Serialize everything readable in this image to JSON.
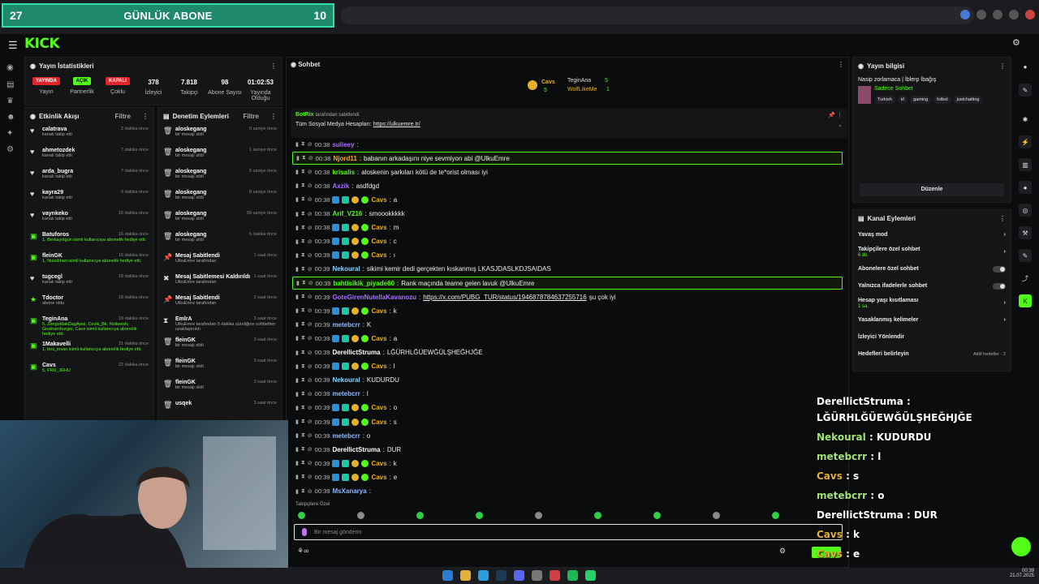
{
  "banner": {
    "left": "27",
    "title": "GÜNLÜK ABONE",
    "right": "10"
  },
  "app": {
    "logo": "KICK"
  },
  "stats": {
    "title": "Yayın İstatistikleri",
    "items": [
      {
        "badge": "YAYINDA",
        "badge_color": "#e2242b",
        "label": "Yayın"
      },
      {
        "badge": "AÇIK",
        "badge_color": "#53fc18",
        "label": "Partnerlik"
      },
      {
        "badge": "KAPALI",
        "badge_color": "#e2242b",
        "label": "Çoklu"
      },
      {
        "value": "378",
        "label": "İzleyici"
      },
      {
        "value": "7.818",
        "label": "Takipçi"
      },
      {
        "value": "98",
        "label": "Abone Sayısı"
      },
      {
        "value": "01:02:53",
        "label": "Yayında Olduğu"
      }
    ]
  },
  "activity": {
    "title": "Etkinlik Akışı",
    "filter": "Filtre",
    "items": [
      {
        "icon": "heart-icon",
        "name": "calatrava",
        "time": "2 dakika önce",
        "sub": "kanalı takip etti"
      },
      {
        "icon": "heart-icon",
        "name": "ahmetozdek",
        "time": "7 dakika önce",
        "sub": "kanalı takip etti"
      },
      {
        "icon": "heart-icon",
        "name": "arda_bugra",
        "time": "7 dakika önce",
        "sub": "kanalı takip etti"
      },
      {
        "icon": "heart-icon",
        "name": "kayra29",
        "time": "9 dakika önce",
        "sub": "kanalı takip etti"
      },
      {
        "icon": "heart-icon",
        "name": "vaynkeko",
        "time": "16 dakika önce",
        "sub": "kanalı takip etti"
      },
      {
        "icon": "gift-icon",
        "name": "Batuforos",
        "time": "16 dakika önce",
        "sub": "1, Berkayolgun isimli kullanıcıya abonelik hediye etti."
      },
      {
        "icon": "gift-icon",
        "name": "fleinGK",
        "time": "16 dakika önce",
        "sub": "1, Nusokhan isimli kullanıcıya abonelik hediye etti."
      },
      {
        "icon": "heart-icon",
        "name": "tugcegl",
        "time": "18 dakika önce",
        "sub": "kanalı takip etti"
      },
      {
        "icon": "star-icon",
        "name": "Tdoctor",
        "time": "18 dakika önce",
        "sub": "abone oldu"
      },
      {
        "icon": "gift-icon",
        "name": "TeginAna",
        "time": "19 dakika önce",
        "sub": "5, ZonguldakDagAyisi, Cevik_Bir, Noliwesh, Gezihamburger, Cavs isimli kullanıcıya abonelik hediye etti."
      },
      {
        "icon": "gift-icon",
        "name": "1Makavelli",
        "time": "21 dakika önce",
        "sub": "1, bos_insan isimli kullanıcıya abonelik hediye etti."
      },
      {
        "icon": "gift-icon",
        "name": "Cavs",
        "time": "22 dakika önce",
        "sub": "5, FRU_JEHU"
      }
    ]
  },
  "mod": {
    "title": "Denetim Eylemleri",
    "filter": "Filtre",
    "items": [
      {
        "icon": "trash-icon",
        "name": "aloskegang",
        "time": "0 saniye önce",
        "sub": "bir mesajı sildi"
      },
      {
        "icon": "trash-icon",
        "name": "aloskegang",
        "time": "1 saniye önce",
        "sub": "bir mesajı sildi"
      },
      {
        "icon": "trash-icon",
        "name": "aloskegang",
        "time": "5 saniye önce",
        "sub": "bir mesajı sildi"
      },
      {
        "icon": "trash-icon",
        "name": "aloskegang",
        "time": "8 saniye önce",
        "sub": "bir mesajı sildi"
      },
      {
        "icon": "trash-icon",
        "name": "aloskegang",
        "time": "59 saniye önce",
        "sub": "bir mesajı sildi"
      },
      {
        "icon": "trash-icon",
        "name": "aloskegang",
        "time": "6 dakika önce",
        "sub": "bir mesajı sildi"
      },
      {
        "icon": "pin-icon",
        "name": "Mesaj Sabitlendi",
        "time": "1 saat önce",
        "sub": "UlkuEmre tarafından"
      },
      {
        "icon": "unpin-icon",
        "name": "Mesaj Sabitlemesi Kaldırıldı",
        "time": "1 saat önce",
        "sub": "UlkuEmre tarafından"
      },
      {
        "icon": "pin-icon",
        "name": "Mesaj Sabitlendi",
        "time": "2 saat önce",
        "sub": "UlkuEmre tarafından"
      },
      {
        "icon": "hourglass-icon",
        "name": "EmlrA",
        "time": "3 saat önce",
        "sub": "UlkuEmre tarafından 5 dakika süreliğine sohbetten uzaklaştırıldı"
      },
      {
        "icon": "trash-icon",
        "name": "fleinGK",
        "time": "3 saat önce",
        "sub": "bir mesajı sildi"
      },
      {
        "icon": "trash-icon",
        "name": "fleinGK",
        "time": "3 saat önce",
        "sub": "bir mesajı sildi"
      },
      {
        "icon": "trash-icon",
        "name": "fleinGK",
        "time": "3 saat önce",
        "sub": "bir mesajı sildi"
      },
      {
        "icon": "trash-icon",
        "name": "usqek",
        "time": "3 saat önce",
        "sub": ""
      }
    ]
  },
  "chat": {
    "title": "Sohbet",
    "top": {
      "u1": "Cavs",
      "c1": "5",
      "u2": "TeginAna",
      "c2": "5",
      "u3": "WolfLikeMe",
      "c3": "1"
    },
    "pinned": {
      "by": "BotRix",
      "suffix": "tarafından sabitlendi",
      "text": "Tüm Sosyal Medya Hesapları:",
      "link": "https://ulkuemre.tr/"
    },
    "messages": [
      {
        "time": "00:38",
        "user": "sulieey",
        "color": "#a970ff",
        "text": "",
        "hl": false
      },
      {
        "time": "00:38",
        "user": "Njord11",
        "color": "#ff9d2e",
        "text": "babanın arkadaşını niye sevmiyon abi @UlkuEmre",
        "hl": true
      },
      {
        "time": "00:38",
        "user": "krisalis",
        "color": "#53fc18",
        "text": "aloskenin şarkıları kötü de te*orist olması iyi",
        "hl": false
      },
      {
        "time": "00:38",
        "user": "Axzik",
        "color": "#a970ff",
        "text": "asdfdgd",
        "hl": false
      },
      {
        "time": "00:38",
        "user": "Cavs",
        "color": "#e5b12b",
        "text": "a",
        "hl": false
      },
      {
        "time": "00:38",
        "user": "Arif_V216",
        "color": "#53fc18",
        "text": "smoookkkkk",
        "hl": false
      },
      {
        "time": "00:38",
        "user": "Cavs",
        "color": "#e5b12b",
        "text": "m",
        "hl": false
      },
      {
        "time": "00:39",
        "user": "Cavs",
        "color": "#e5b12b",
        "text": "c",
        "hl": false
      },
      {
        "time": "00:39",
        "user": "Cavs",
        "color": "#e5b12b",
        "text": "ı",
        "hl": false
      },
      {
        "time": "00:39",
        "user": "Nekoural",
        "color": "#8fd3ff",
        "text": "sikimi kemir dedi gerçekten kıskanmış LKASJDASLKDJSAIDAS",
        "hl": false
      },
      {
        "time": "00:39",
        "user": "bahtisikik_piyade60",
        "color": "#53fc18",
        "text": "Rank maçında teame gelen lavuk @UlkuEmre",
        "hl": true
      },
      {
        "time": "00:39",
        "user": "GoteGirenNutellaKavanozu",
        "color": "#a970ff",
        "text": "https://x.com/PUBG_TUR/status/1946878784637255716",
        "text2": "şu çok iyi",
        "hl": false
      },
      {
        "time": "00:39",
        "user": "Cavs",
        "color": "#e5b12b",
        "text": "k",
        "hl": false
      },
      {
        "time": "00:39",
        "user": "metebcrr",
        "color": "#8fb8ff",
        "text": "K",
        "hl": false
      },
      {
        "time": "00:39",
        "user": "Cavs",
        "color": "#e5b12b",
        "text": "a",
        "hl": false
      },
      {
        "time": "00:39",
        "user": "DerellictStruma",
        "color": "#ffffff",
        "text": "LĞÜRHLĞÜEWĞÜLŞHEĞHJĞE",
        "hl": false
      },
      {
        "time": "00:39",
        "user": "Cavs",
        "color": "#e5b12b",
        "text": "l",
        "hl": false
      },
      {
        "time": "00:39",
        "user": "Nekoural",
        "color": "#8fd3ff",
        "text": "KUDURDU",
        "hl": false
      },
      {
        "time": "00:39",
        "user": "metebcrr",
        "color": "#8fb8ff",
        "text": "l",
        "hl": false
      },
      {
        "time": "00:39",
        "user": "Cavs",
        "color": "#e5b12b",
        "text": "o",
        "hl": false
      },
      {
        "time": "00:39",
        "user": "Cavs",
        "color": "#e5b12b",
        "text": "s",
        "hl": false
      },
      {
        "time": "00:39",
        "user": "metebcrr",
        "color": "#8fb8ff",
        "text": "o",
        "hl": false
      },
      {
        "time": "00:39",
        "user": "DerellictStruma",
        "color": "#ffffff",
        "text": "DUR",
        "hl": false
      },
      {
        "time": "00:39",
        "user": "Cavs",
        "color": "#e5b12b",
        "text": "k",
        "hl": false
      },
      {
        "time": "00:39",
        "user": "Cavs",
        "color": "#e5b12b",
        "text": "e",
        "hl": false
      },
      {
        "time": "00:39",
        "user": "MsXanarya",
        "color": "#8fb8ff",
        "text": "",
        "hl": false
      }
    ],
    "followers_only": "Takipçilere Özel",
    "input_placeholder": "Bir mesaj gönderin",
    "points": "∞"
  },
  "streaminfo": {
    "title": "Yayın bilgisi",
    "stream_title": "Nasip zorlamaca | İblerp İbağış",
    "mode": "Sadece Sohbet",
    "tags": [
      "Turkish",
      "irl",
      "gaming",
      "futbol",
      "justchatting"
    ],
    "edit": "Düzenle"
  },
  "actions": {
    "title": "Kanal Eylemleri",
    "items": [
      {
        "label": "Yavaş mod",
        "sub": "",
        "ctrl": "arrow"
      },
      {
        "label": "Takipçilere özel sohbet",
        "sub": "6 dk.",
        "ctrl": "arrow"
      },
      {
        "label": "Abonelere özel sohbet",
        "sub": "",
        "ctrl": "toggle"
      },
      {
        "label": "Yalnızca ifadelerle sohbet",
        "sub": "",
        "ctrl": "toggle"
      },
      {
        "label": "Hesap yaşı kısıtlaması",
        "sub": "1 sa.",
        "ctrl": "arrow"
      },
      {
        "label": "Yasaklanmış kelimeler",
        "sub": "",
        "ctrl": "arrow"
      },
      {
        "label": "İzleyici Yönlendir",
        "sub": "",
        "ctrl": ""
      },
      {
        "label": "Hedefleri belirleyin",
        "sub": "",
        "ctrl": "goal",
        "goal": "Aktif hedefler · 2"
      }
    ]
  },
  "overlay": [
    {
      "user": "DerellictStruma",
      "text": ":"
    },
    {
      "user": "",
      "text": "LĞÜRHLĞÜEWĞÜLŞHEĞHJĞE"
    },
    {
      "user": "Nekoural",
      "text": ": KUDURDU"
    },
    {
      "user": "metebcrr",
      "text": ": l"
    },
    {
      "user": "Cavs",
      "text": ": s"
    },
    {
      "user": "metebcrr",
      "text": ": o"
    },
    {
      "user": "DerellictStruma",
      "text": ": DUR"
    },
    {
      "user": "Cavs",
      "text": ": k"
    },
    {
      "user": "Cavs",
      "text": ": e"
    }
  ],
  "clock": {
    "time": "00:39",
    "date": "21.07.2025"
  }
}
